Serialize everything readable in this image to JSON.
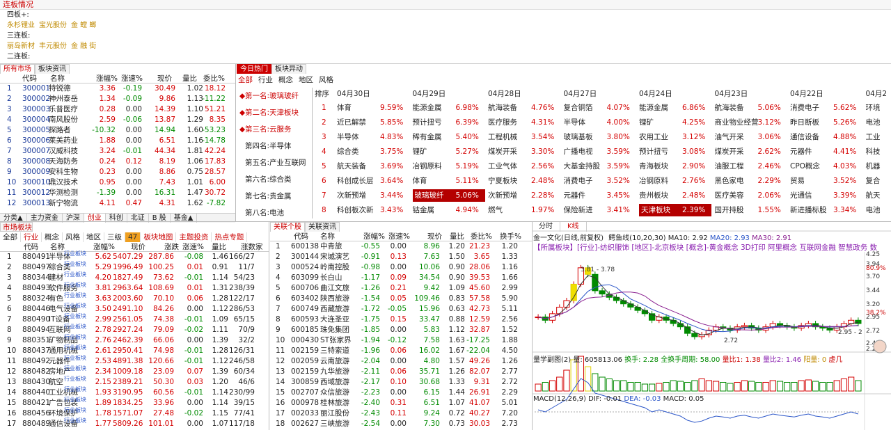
{
  "lianban": {
    "title": "连板情况",
    "rows": [
      {
        "label": "四板+:",
        "stocks": []
      },
      {
        "label": "",
        "stocks": [
          "永杉锂业",
          "宝光股份",
          "金 螳 螂"
        ]
      },
      {
        "label": "三连板:",
        "stocks": []
      },
      {
        "label": "",
        "stocks": [
          "丽岛新材",
          "丰元股份",
          "金 融 街"
        ]
      },
      {
        "label": "二连板:",
        "stocks": []
      }
    ]
  },
  "left_tabs": [
    "所有市场",
    "板块资讯"
  ],
  "stock_table": {
    "headers": [
      "代码",
      "名称",
      "涨幅%",
      "涨速%",
      "现价",
      "量比",
      "委比%"
    ],
    "rows": [
      [
        "1",
        "300001",
        "特锐德",
        "3.36",
        "-0.19",
        "30.49",
        "1.02",
        "18.12"
      ],
      [
        "2",
        "300002",
        "神州泰岳",
        "1.34",
        "-0.09",
        "9.86",
        "1.13",
        "-11.22"
      ],
      [
        "3",
        "300003",
        "乐普医疗",
        "0.28",
        "0.00",
        "14.39",
        "1.10",
        "51.21"
      ],
      [
        "4",
        "300004",
        "南风股份",
        "2.59",
        "-0.06",
        "13.87",
        "1.29",
        "8.35"
      ],
      [
        "5",
        "300005",
        "探路者",
        "-10.32",
        "0.00",
        "14.94",
        "1.60",
        "-53.23"
      ],
      [
        "6",
        "300006",
        "莱美药业",
        "1.88",
        "0.00",
        "6.51",
        "1.16",
        "-14.78"
      ],
      [
        "7",
        "300007",
        "汉威科技",
        "3.24",
        "-0.01",
        "44.34",
        "1.81",
        "42.24"
      ],
      [
        "8",
        "300008",
        "天海防务",
        "0.24",
        "0.12",
        "8.19",
        "1.06",
        "17.83"
      ],
      [
        "9",
        "300009",
        "安科生物",
        "0.23",
        "0.00",
        "8.86",
        "0.75",
        "28.57"
      ],
      [
        "10",
        "300010",
        "鼎汉技术",
        "0.95",
        "0.00",
        "7.43",
        "1.01",
        "6.00"
      ],
      [
        "11",
        "300012",
        "华测检测",
        "-1.39",
        "0.00",
        "16.31",
        "1.47",
        "30.72"
      ],
      [
        "12",
        "300013",
        "新宁物流",
        "4.11",
        "0.47",
        "4.31",
        "1.62",
        "-7.82"
      ]
    ]
  },
  "bottom_tabs": [
    "分类▲",
    "主力资金",
    "沪深",
    "创业",
    "科创",
    "北证",
    "B 股",
    "基金▲"
  ],
  "hot": {
    "tabs": [
      "今日热门",
      "板块异动"
    ],
    "subtabs": [
      "全部",
      "行业",
      "概念",
      "地区",
      "风格"
    ],
    "menu": [
      "第一名:玻璃玻纤",
      "第二名:天津板块",
      "第三名:云服务",
      "第四名:半导体",
      "第五名:产业互联网",
      "第六名:综合类",
      "第七名:贵金属",
      "第八名:电池"
    ],
    "rank_header": "排序",
    "dates": [
      "04月30日",
      "04月29日",
      "04月28日",
      "04月27日",
      "04月24日",
      "04月23日",
      "04月22日",
      "04月2"
    ],
    "rows": [
      {
        "rank": "1",
        "cells": [
          [
            "体育",
            "9.59%"
          ],
          [
            "能源金属",
            "6.98%"
          ],
          [
            "航海装备",
            "4.76%"
          ],
          [
            "复合铜箔",
            "4.07%"
          ],
          [
            "能源金属",
            "6.86%"
          ],
          [
            "航海装备",
            "5.06%"
          ],
          [
            "消费电子",
            "5.62%"
          ],
          [
            "环境"
          ]
        ]
      },
      {
        "rank": "2",
        "cells": [
          [
            "近已解禁",
            "5.85%"
          ],
          [
            "预计扭亏",
            "6.39%"
          ],
          [
            "医疗服务",
            "4.31%"
          ],
          [
            "半导体",
            "4.00%"
          ],
          [
            "锂矿",
            "4.25%"
          ],
          [
            "商业物业经营",
            "3.12%"
          ],
          [
            "昨日断板",
            "5.26%"
          ],
          [
            "电池"
          ]
        ]
      },
      {
        "rank": "3",
        "cells": [
          [
            "半导体",
            "4.83%"
          ],
          [
            "稀有金属",
            "5.40%"
          ],
          [
            "工程机械",
            "3.54%"
          ],
          [
            "玻璃基板",
            "3.80%"
          ],
          [
            "农用工业",
            "3.12%"
          ],
          [
            "油气开采",
            "3.06%"
          ],
          [
            "通信设备",
            "4.88%"
          ],
          [
            "工业"
          ]
        ]
      },
      {
        "rank": "4",
        "cells": [
          [
            "综合类",
            "3.75%"
          ],
          [
            "锂矿",
            "5.27%"
          ],
          [
            "煤炭开采",
            "3.30%"
          ],
          [
            "广播电视",
            "3.59%"
          ],
          [
            "预计扭亏",
            "3.08%"
          ],
          [
            "煤炭开采",
            "2.62%"
          ],
          [
            "元器件",
            "4.41%"
          ],
          [
            "科技"
          ]
        ]
      },
      {
        "rank": "5",
        "cells": [
          [
            "航天装备",
            "3.69%"
          ],
          [
            "冶钢原料",
            "5.19%"
          ],
          [
            "工业气体",
            "2.56%"
          ],
          [
            "大基金持股",
            "3.59%"
          ],
          [
            "青海板块",
            "2.90%"
          ],
          [
            "油服工程",
            "2.46%"
          ],
          [
            "CPO概念",
            "4.03%"
          ],
          [
            "机器"
          ]
        ]
      },
      {
        "rank": "6",
        "cells": [
          [
            "科创成长层",
            "3.64%"
          ],
          [
            "体育",
            "5.11%"
          ],
          [
            "宁夏板块",
            "2.48%"
          ],
          [
            "消费电子",
            "3.52%"
          ],
          [
            "冶钢原料",
            "2.76%"
          ],
          [
            "黑色家电",
            "2.29%"
          ],
          [
            "贸易",
            "3.52%"
          ],
          [
            "复合"
          ]
        ]
      },
      {
        "rank": "7",
        "cells": [
          [
            "次新预增",
            "3.44%"
          ],
          [
            "玻璃玻纤",
            "5.06%"
          ],
          [
            "次新预增",
            "2.28%"
          ],
          [
            "元器件",
            "3.45%"
          ],
          [
            "贵州板块",
            "2.48%"
          ],
          [
            "医疗美容",
            "2.06%"
          ],
          [
            "光通信",
            "3.39%"
          ],
          [
            "航天"
          ]
        ]
      },
      {
        "rank": "8",
        "cells": [
          [
            "科创板次新",
            "3.43%"
          ],
          [
            "钴金属",
            "4.94%"
          ],
          [
            "燃气",
            "1.97%"
          ],
          [
            "保险新进",
            "3.41%"
          ],
          [
            "天津板块",
            "2.39%"
          ],
          [
            "国开持股",
            "1.55%"
          ],
          [
            "新进播标股",
            "3.34%"
          ],
          [
            "电池"
          ]
        ]
      }
    ]
  },
  "market": {
    "title": "市场板块",
    "subtabs": [
      "全部",
      "行业",
      "概念",
      "风格",
      "地区",
      "三级",
      "47",
      "板块地图",
      "主题投资",
      "热点专题"
    ],
    "headers": [
      "代码",
      "名称",
      "涨幅%",
      "现价",
      "涨跌",
      "涨速%",
      "量比",
      "涨数家"
    ],
    "tag": "行业板块",
    "rows": [
      [
        "1",
        "880491",
        "半导体",
        "5.62",
        "5407.29",
        "287.86",
        "-0.08",
        "1.46",
        "166/27"
      ],
      [
        "2",
        "880497",
        "综合类",
        "5.29",
        "1996.49",
        "100.25",
        "0.01",
        "0.91",
        "11/7"
      ],
      [
        "3",
        "880344",
        "建材",
        "4.20",
        "1827.49",
        "73.62",
        "-0.01",
        "1.14",
        "54/23"
      ],
      [
        "4",
        "880493",
        "软件服务",
        "3.81",
        "2963.64",
        "108.69",
        "0.01",
        "1.31",
        "238/39"
      ],
      [
        "5",
        "880324",
        "有色",
        "3.63",
        "2003.60",
        "70.10",
        "0.06",
        "1.28",
        "122/17"
      ],
      [
        "6",
        "880446",
        "电气设备",
        "3.50",
        "2491.10",
        "84.26",
        "0.00",
        "1.12",
        "286/53"
      ],
      [
        "7",
        "880490",
        "IT设备",
        "2.99",
        "2561.05",
        "74.38",
        "-0.01",
        "1.09",
        "65/15"
      ],
      [
        "8",
        "880494",
        "互联网",
        "2.78",
        "2927.24",
        "79.09",
        "-0.02",
        "1.11",
        "70/9"
      ],
      [
        "9",
        "880351",
        "矿物制品",
        "2.76",
        "2462.39",
        "66.06",
        "0.00",
        "1.39",
        "32/2"
      ],
      [
        "10",
        "880437",
        "通用机械",
        "2.61",
        "2950.41",
        "74.98",
        "-0.01",
        "1.28",
        "126/31"
      ],
      [
        "11",
        "880492",
        "元器件",
        "2.53",
        "4891.38",
        "120.66",
        "-0.01",
        "1.12",
        "246/58"
      ],
      [
        "12",
        "880482",
        "房地产",
        "2.34",
        "1009.18",
        "23.09",
        "0.07",
        "1.39",
        "60/34"
      ],
      [
        "13",
        "880430",
        "航空",
        "2.15",
        "2389.21",
        "50.30",
        "0.03",
        "1.20",
        "46/6"
      ],
      [
        "14",
        "880440",
        "工业机械",
        "1.93",
        "3190.95",
        "60.56",
        "-0.01",
        "1.14",
        "230/99"
      ],
      [
        "15",
        "880421",
        "广告包装",
        "1.89",
        "1834.25",
        "33.96",
        "0.00",
        "1.14",
        "39/15"
      ],
      [
        "16",
        "880456",
        "环境保护",
        "1.78",
        "1571.07",
        "27.48",
        "-0.02",
        "1.15",
        "77/41"
      ],
      [
        "17",
        "880489",
        "通信设备",
        "1.77",
        "5809.26",
        "101.01",
        "0.00",
        "1.07",
        "117/18"
      ]
    ]
  },
  "related": {
    "tabs": [
      "关联个股",
      "关联资讯"
    ],
    "headers": [
      "代码",
      "名称",
      "涨幅%",
      "涨速%",
      "现价",
      "量比",
      "委比%",
      "换手%"
    ],
    "rows": [
      [
        "1",
        "600138",
        "中青旅",
        "-0.55",
        "0.00",
        "8.96",
        "1.20",
        "21.23",
        "1.20"
      ],
      [
        "2",
        "300144",
        "宋城演艺",
        "-0.91",
        "0.13",
        "7.63",
        "1.50",
        "3.65",
        "1.33"
      ],
      [
        "3",
        "000524",
        "岭南控股",
        "-0.98",
        "0.00",
        "10.06",
        "0.90",
        "28.06",
        "1.16"
      ],
      [
        "4",
        "603099",
        "长白山",
        "-1.17",
        "0.09",
        "34.54",
        "0.90",
        "39.53",
        "1.66"
      ],
      [
        "5",
        "600706",
        "曲江文旅",
        "-1.26",
        "0.21",
        "9.42",
        "1.09",
        "45.60",
        "2.99"
      ],
      [
        "6",
        "603402",
        "陕西旅游",
        "-1.54",
        "0.05",
        "109.46",
        "0.83",
        "57.58",
        "5.90"
      ],
      [
        "7",
        "600749",
        "西藏旅游",
        "-1.72",
        "-0.05",
        "15.96",
        "0.63",
        "42.73",
        "5.11"
      ],
      [
        "8",
        "600593",
        "大连圣亚",
        "-1.75",
        "0.15",
        "33.47",
        "0.88",
        "12.59",
        "2.56"
      ],
      [
        "9",
        "600185",
        "珠免集团",
        "-1.85",
        "0.00",
        "5.83",
        "1.12",
        "32.87",
        "1.52"
      ],
      [
        "10",
        "000430",
        "ST张家界",
        "-1.94",
        "-0.12",
        "7.58",
        "1.63",
        "-17.25",
        "1.88"
      ],
      [
        "11",
        "002159",
        "三特索道",
        "-1.96",
        "0.06",
        "16.02",
        "1.67",
        "-22.04",
        "4.50"
      ],
      [
        "12",
        "002059",
        "云南旅游",
        "-2.04",
        "0.00",
        "4.80",
        "1.57",
        "49.26",
        "1.26"
      ],
      [
        "13",
        "002159",
        "九华旅游",
        "-2.11",
        "0.06",
        "35.71",
        "1.26",
        "82.07",
        "2.77"
      ],
      [
        "14",
        "300859",
        "西域旅游",
        "-2.17",
        "0.10",
        "30.68",
        "1.33",
        "9.31",
        "2.72"
      ],
      [
        "15",
        "002707",
        "众信旅游",
        "-2.23",
        "0.00",
        "6.15",
        "1.44",
        "26.91",
        "2.29"
      ],
      [
        "16",
        "000978",
        "桂林旅游",
        "-2.40",
        "0.31",
        "6.51",
        "1.07",
        "41.07",
        "5.01"
      ],
      [
        "17",
        "002033",
        "丽江股份",
        "-2.43",
        "0.11",
        "9.24",
        "0.72",
        "40.27",
        "7.20"
      ],
      [
        "18",
        "002627",
        "三峡旅游",
        "-2.54",
        "0.00",
        "7.30",
        "0.73",
        "30.03",
        "2.73"
      ]
    ]
  },
  "chart": {
    "tabs": [
      "分时",
      "K线"
    ],
    "title": "金一文化(日线,前复权)",
    "ma_label": "鳄鱼线(10,20,30)",
    "ma10": "MA10: 2.92",
    "ma20": "MA20: 2.93",
    "ma30": "MA30: 2.91",
    "concept": "【所属板块】[行业]-纺织服饰 [地区]-北京板块 [概念]-黄金概念 3D打印 阿里概念 互联网金融 智慧政务 数",
    "annot_high": "3.81 - 3.78",
    "annot_low": "2.72",
    "annot_last": "2.95 - 2",
    "yaxis": [
      "4.25",
      "3.94",
      "80.9%",
      "3.70",
      "3.44",
      "3.20",
      "38.2%",
      "2.95",
      "2.72",
      "2.47",
      "2.26"
    ],
    "vol_title": "量学副图(2)",
    "vol_value": "量: 605813.06",
    "turnover": "换手: 2.28",
    "full_turnover": "全换手周期: 58.00",
    "lb1": "量比1: 1.38",
    "lb2": "量比2: 1.46",
    "yang": "阳量: 0",
    "xu": "虚几",
    "macd_label": "MACD(12,26,9)",
    "dif": "DIF: -0.01",
    "dea": "DEA: -0.03",
    "macd": "MACD: 0.05",
    "kline": [
      3.05,
      3.0,
      3.1,
      3.2,
      3.3,
      3.55,
      3.8,
      3.7,
      3.45,
      3.4,
      3.35,
      3.3,
      3.25,
      3.2,
      3.15,
      3.1,
      3.0,
      3.05,
      3.0,
      2.95,
      2.9,
      2.8,
      2.75,
      2.78,
      2.85,
      2.9,
      2.88,
      2.85,
      2.9,
      2.92,
      2.88,
      2.85,
      2.9,
      2.95,
      2.92,
      2.9,
      2.88,
      2.92,
      2.95,
      2.9,
      2.88,
      2.85,
      2.9,
      2.95,
      3.0,
      2.95
    ],
    "volume": [
      2,
      2.5,
      3,
      4,
      6,
      9,
      10,
      7,
      5,
      4,
      3.5,
      3,
      3,
      2.5,
      2.5,
      2,
      2,
      2.2,
      2.5,
      3,
      2.8,
      2.5,
      3,
      3.5,
      3,
      2.8,
      2.5,
      2.2,
      2.5,
      3,
      2.8,
      2.5,
      2.5,
      3,
      2.8,
      2.5,
      2.5,
      3,
      3.2,
      2.8,
      2.5,
      2.5,
      3,
      3.5,
      4,
      3
    ]
  },
  "colors": {
    "up": "#d40000",
    "down": "#008a00",
    "accent": "#c00000",
    "gold": "#c08a00"
  }
}
